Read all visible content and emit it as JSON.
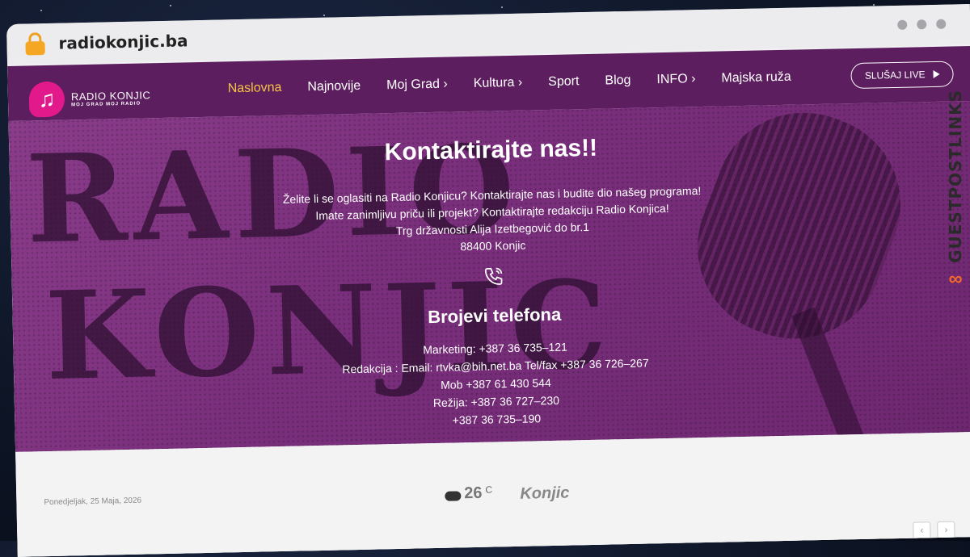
{
  "browser": {
    "url": "radiokonjic.ba"
  },
  "logo": {
    "title": "RADIO KONJIC",
    "tagline": "MOJ GRAD MOJ RADIO"
  },
  "nav": {
    "items": [
      {
        "label": "Naslovna",
        "active": true
      },
      {
        "label": "Najnovije"
      },
      {
        "label": "Moj Grad ›"
      },
      {
        "label": "Kultura ›"
      },
      {
        "label": "Sport"
      },
      {
        "label": "Blog"
      },
      {
        "label": "INFO ›"
      },
      {
        "label": "Majska ruža"
      }
    ],
    "live_label": "SLUŠAJ LIVE"
  },
  "hero": {
    "bg_words": [
      "RADIO",
      "KONJIC"
    ],
    "title": "Kontaktirajte nas!!",
    "lines": [
      "Želite li se oglasiti na Radio Konjicu? Kontaktirajte nas i budite dio našeg programa!",
      "Imate zanimljivu priču ili projekt? Kontaktirajte redakciju Radio Konjica!",
      "Trg državnosti Alija Izetbegović do br.1",
      "88400 Konjic"
    ],
    "phones_title": "Brojevi telefona",
    "phones": [
      "Marketing: +387 36 735–121",
      "Redakcija : Email: rtvka@bih.net.ba Tel/fax +387 36 726–267",
      "Mob +387 61 430 544",
      "Režija: +387 36 727–230",
      "+387 36 735–190"
    ]
  },
  "info_bar": {
    "date": "Ponedjeljak, 25 Maja, 2026",
    "temperature": "26",
    "unit": "C",
    "city": "Konjic"
  },
  "watermark": {
    "text": "GUESTPOSTLINKS"
  },
  "colors": {
    "nav_bg": "#5c1e5e",
    "active": "#f6c545",
    "hero": "#7a2f7c",
    "watermark_accent": "#f26b2b"
  }
}
